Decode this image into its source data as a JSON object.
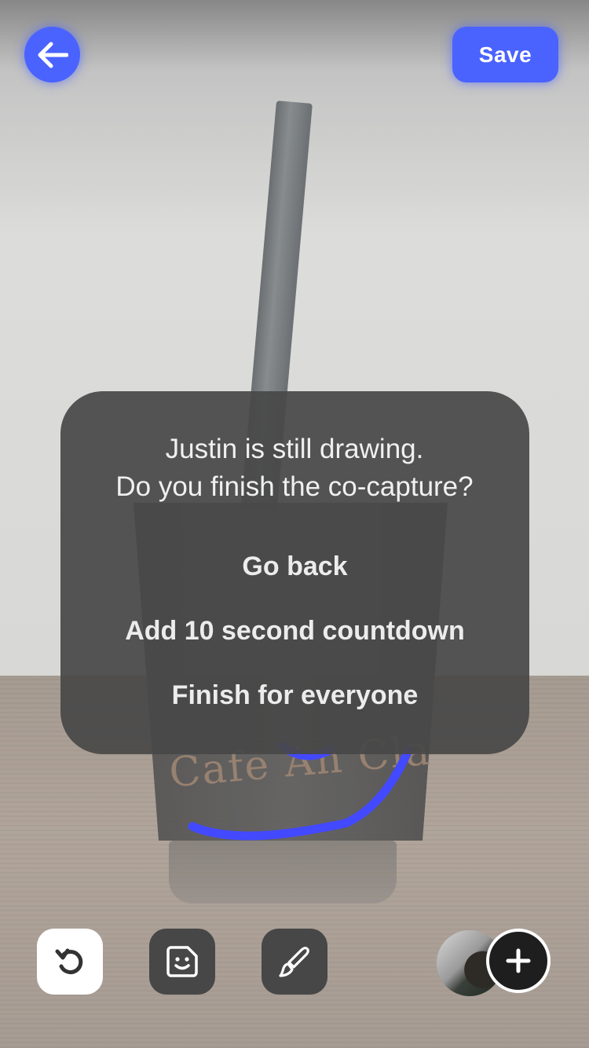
{
  "header": {
    "back_icon": "arrow-left-icon",
    "save_label": "Save"
  },
  "dialog": {
    "message_line1": "Justin is still drawing.",
    "message_line2": "Do you finish the co-capture?",
    "options": [
      {
        "label": "Go back"
      },
      {
        "label": "Add 10 second countdown"
      },
      {
        "label": "Finish for everyone"
      }
    ]
  },
  "photo": {
    "cup_text": "Cafe An Cla"
  },
  "toolbar": {
    "undo_icon": "undo-icon",
    "sticker_icon": "sticker-icon",
    "brush_icon": "brush-icon",
    "add_icon": "plus-icon"
  },
  "colors": {
    "accent": "#4a63ff",
    "dialog_bg": "#484848",
    "drawing_stroke": "#2e35ff"
  }
}
